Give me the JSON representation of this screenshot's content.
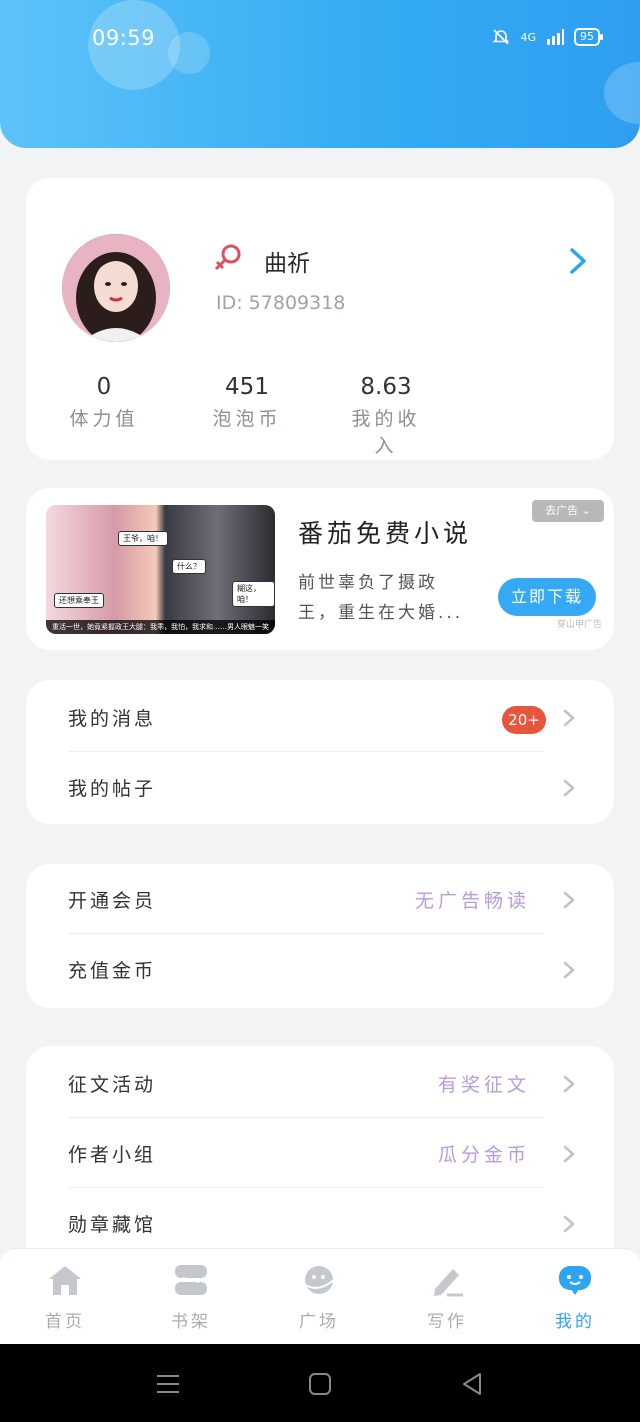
{
  "status": {
    "time": "09:59",
    "network": "4G",
    "battery": "95"
  },
  "profile": {
    "name": "曲祈",
    "id_text": "ID: 57809318",
    "stats": [
      {
        "value": "0",
        "label": "体力值"
      },
      {
        "value": "451",
        "label": "泡泡币"
      },
      {
        "value": "8.63",
        "label": "我的收入"
      }
    ]
  },
  "ad": {
    "title": "番茄免费小说",
    "description": "前世辜负了摄政王，重生在大婚...",
    "button": "立即下载",
    "remove_label": "去广告",
    "source": "穿山甲广告",
    "image_caption": "重活一世，她竟紧握政王大腿：我乖，我怕，我求和……男人眼魅一笑",
    "image_bubbles": [
      "还想乘奉王",
      "王爷，咱！",
      "什么？",
      "糊这，咱！"
    ]
  },
  "menu_groups": [
    [
      {
        "label": "我的消息",
        "badge": "20+"
      },
      {
        "label": "我的帖子"
      }
    ],
    [
      {
        "label": "开通会员",
        "extra": "无广告畅读"
      },
      {
        "label": "充值金币"
      }
    ],
    [
      {
        "label": "征文活动",
        "extra": "有奖征文"
      },
      {
        "label": "作者小组",
        "extra": "瓜分金币"
      },
      {
        "label": "勋章藏馆"
      }
    ]
  ],
  "tabs": [
    {
      "label": "首页",
      "icon": "home-icon"
    },
    {
      "label": "书架",
      "icon": "bookshelf-icon"
    },
    {
      "label": "广场",
      "icon": "planet-icon"
    },
    {
      "label": "写作",
      "icon": "pencil-icon"
    },
    {
      "label": "我的",
      "icon": "chat-bubble-icon",
      "active": true
    }
  ],
  "colors": {
    "accent": "#2ea5f2",
    "badge": "#e5563c",
    "extra_text": "#b99be0",
    "gender": "#e05060"
  }
}
